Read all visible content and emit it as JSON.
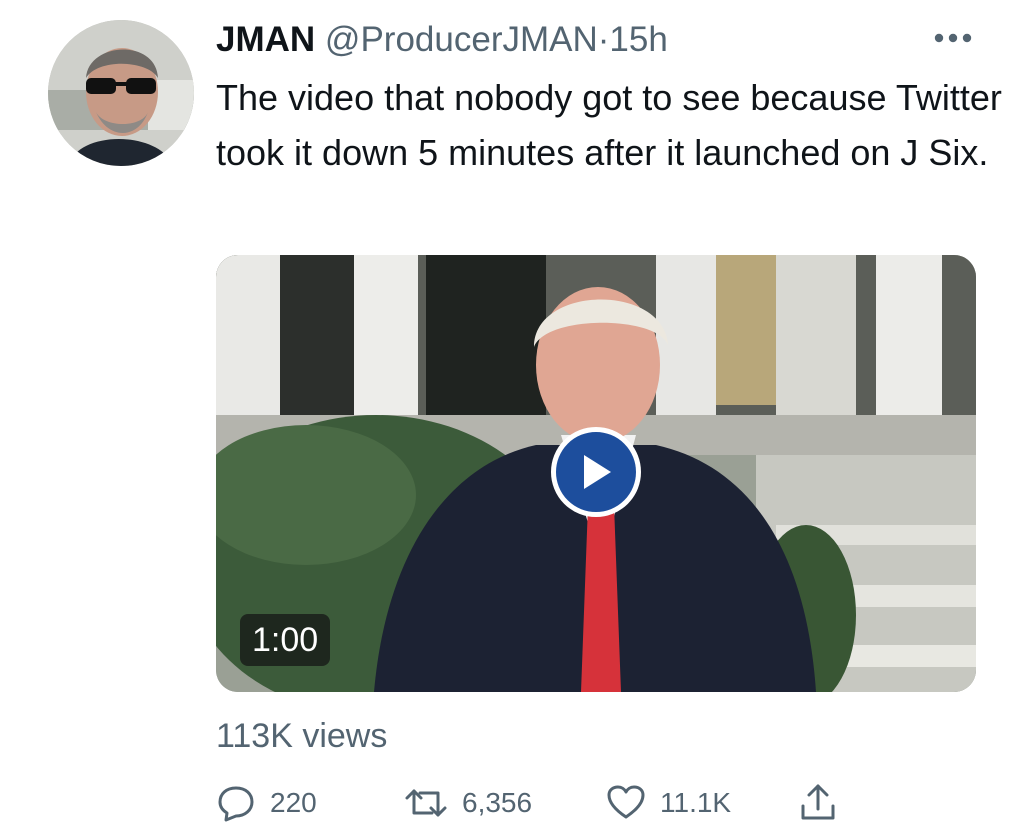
{
  "tweet": {
    "author_name": "JMAN",
    "handle": "@ProducerJMAN",
    "separator": "·",
    "time": "15h",
    "text": "The video that nobody got to see because Twitter took it down 5 minutes after it launched on J Six.",
    "more_icon": "more-horizontal-icon"
  },
  "media": {
    "type": "video",
    "duration": "1:00",
    "play_icon": "play-icon",
    "play_button_color": "#1d4e9d"
  },
  "stats": {
    "views": "113K views"
  },
  "actions": {
    "replies": "220",
    "retweets": "6,356",
    "likes": "11.1K",
    "reply_icon": "reply-icon",
    "retweet_icon": "retweet-icon",
    "like_icon": "heart-icon",
    "share_icon": "share-icon"
  },
  "colors": {
    "text": "#0f1419",
    "secondary": "#536471"
  }
}
